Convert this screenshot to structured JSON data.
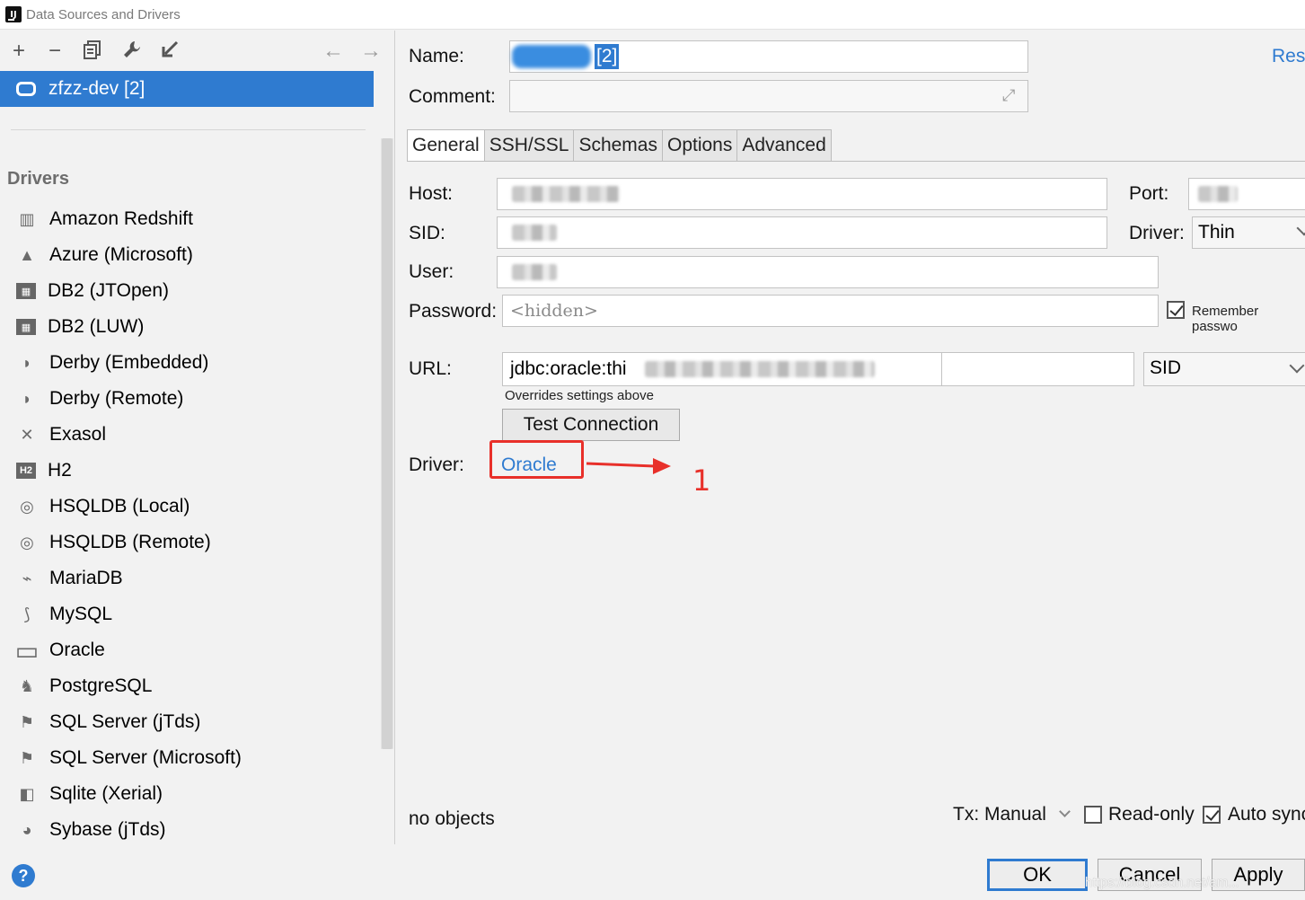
{
  "window": {
    "title": "Data Sources and Drivers"
  },
  "sidebar": {
    "selected_datasource": "zfzz-dev [2]",
    "drivers_heading": "Drivers",
    "drivers": [
      {
        "label": "Amazon Redshift",
        "icon": "redshift-icon"
      },
      {
        "label": "Azure (Microsoft)",
        "icon": "azure-icon"
      },
      {
        "label": "DB2 (JTOpen)",
        "icon": "db2-icon"
      },
      {
        "label": "DB2 (LUW)",
        "icon": "db2-icon"
      },
      {
        "label": "Derby (Embedded)",
        "icon": "derby-icon"
      },
      {
        "label": "Derby (Remote)",
        "icon": "derby-icon"
      },
      {
        "label": "Exasol",
        "icon": "exasol-icon"
      },
      {
        "label": "H2",
        "icon": "h2-icon"
      },
      {
        "label": "HSQLDB (Local)",
        "icon": "hsqldb-icon"
      },
      {
        "label": "HSQLDB (Remote)",
        "icon": "hsqldb-icon"
      },
      {
        "label": "MariaDB",
        "icon": "mariadb-icon"
      },
      {
        "label": "MySQL",
        "icon": "mysql-icon"
      },
      {
        "label": "Oracle",
        "icon": "oracle-icon"
      },
      {
        "label": "PostgreSQL",
        "icon": "postgresql-icon"
      },
      {
        "label": "SQL Server (jTds)",
        "icon": "sqlserver-icon"
      },
      {
        "label": "SQL Server (Microsoft)",
        "icon": "sqlserver-icon"
      },
      {
        "label": "Sqlite (Xerial)",
        "icon": "sqlite-icon"
      },
      {
        "label": "Sybase (jTds)",
        "icon": "sybase-icon"
      }
    ]
  },
  "form": {
    "name_label": "Name:",
    "name_value": "[2]",
    "reset_label": "Rese",
    "comment_label": "Comment:",
    "tabs": [
      "General",
      "SSH/SSL",
      "Schemas",
      "Options",
      "Advanced"
    ],
    "host_label": "Host:",
    "port_label": "Port:",
    "sid_label": "SID:",
    "driver_type_label": "Driver:",
    "driver_type_value": "Thin",
    "user_label": "User:",
    "password_label": "Password:",
    "password_placeholder": "<hidden>",
    "remember_password_label": "Remember passwo",
    "url_label": "URL:",
    "url_value": "jdbc:oracle:thi",
    "url_type_value": "SID",
    "overrides_note": "Overrides settings above",
    "test_connection_label": "Test Connection",
    "driver_label": "Driver:",
    "driver_link": "Oracle",
    "annotation_number": "1",
    "status_text": "no objects",
    "tx_label": "Tx: Manual",
    "readonly_label": "Read-only",
    "autosync_label": "Auto sync"
  },
  "footer": {
    "help": "?",
    "ok_label": "OK",
    "cancel_label": "Cancel",
    "apply_label": "Apply",
    "watermark": "https://blog.csdn.net/am..."
  },
  "colors": {
    "accent": "#2f7bd0",
    "annotation_red": "#e8302a"
  }
}
